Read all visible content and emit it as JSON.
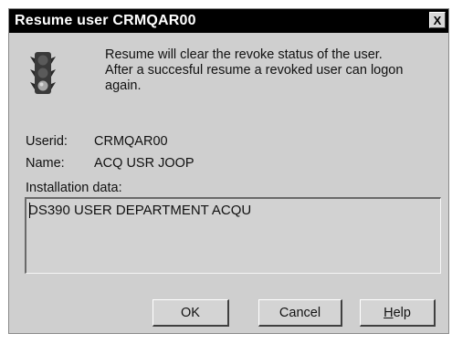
{
  "window": {
    "title": "Resume user CRMQAR00",
    "close_glyph": "X"
  },
  "icon": {
    "name": "traffic-light-icon"
  },
  "message": {
    "line1": "Resume will clear the revoke status of the user.",
    "line2": "After a succesful resume a revoked user can logon",
    "line3": "again."
  },
  "fields": {
    "userid_label": "Userid:",
    "userid_value": "CRMQAR00",
    "name_label": "Name:",
    "name_value": "ACQ USR JOOP",
    "installation_label": "Installation data:",
    "installation_value": "DS390 USER DEPARTMENT ACQU"
  },
  "buttons": {
    "ok_label": "OK",
    "cancel_label": "Cancel",
    "help_first": "H",
    "help_rest": "elp"
  }
}
